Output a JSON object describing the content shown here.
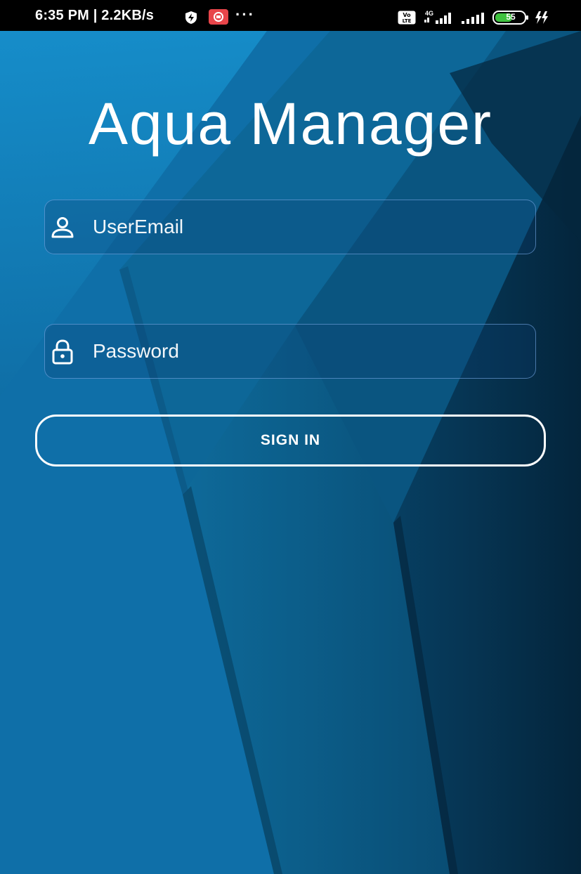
{
  "status_bar": {
    "time": "6:35 PM | 2.2KB/s",
    "more": "···",
    "network": "4G",
    "battery": "55",
    "icons": [
      "data-saver-icon",
      "notification-app-icon",
      "volte-icon",
      "signal-4g-icon",
      "signal-icon",
      "battery-icon",
      "charging-icon"
    ]
  },
  "app": {
    "title": "Aqua Manager"
  },
  "form": {
    "email_placeholder": "UserEmail",
    "password_placeholder": "Password",
    "signin_label": "SIGN IN",
    "email_icon": "user-icon",
    "password_icon": "lock-icon"
  },
  "colors": {
    "background": "#0c5c88",
    "accent_white": "#ffffff",
    "field_border": "#78aae6"
  }
}
